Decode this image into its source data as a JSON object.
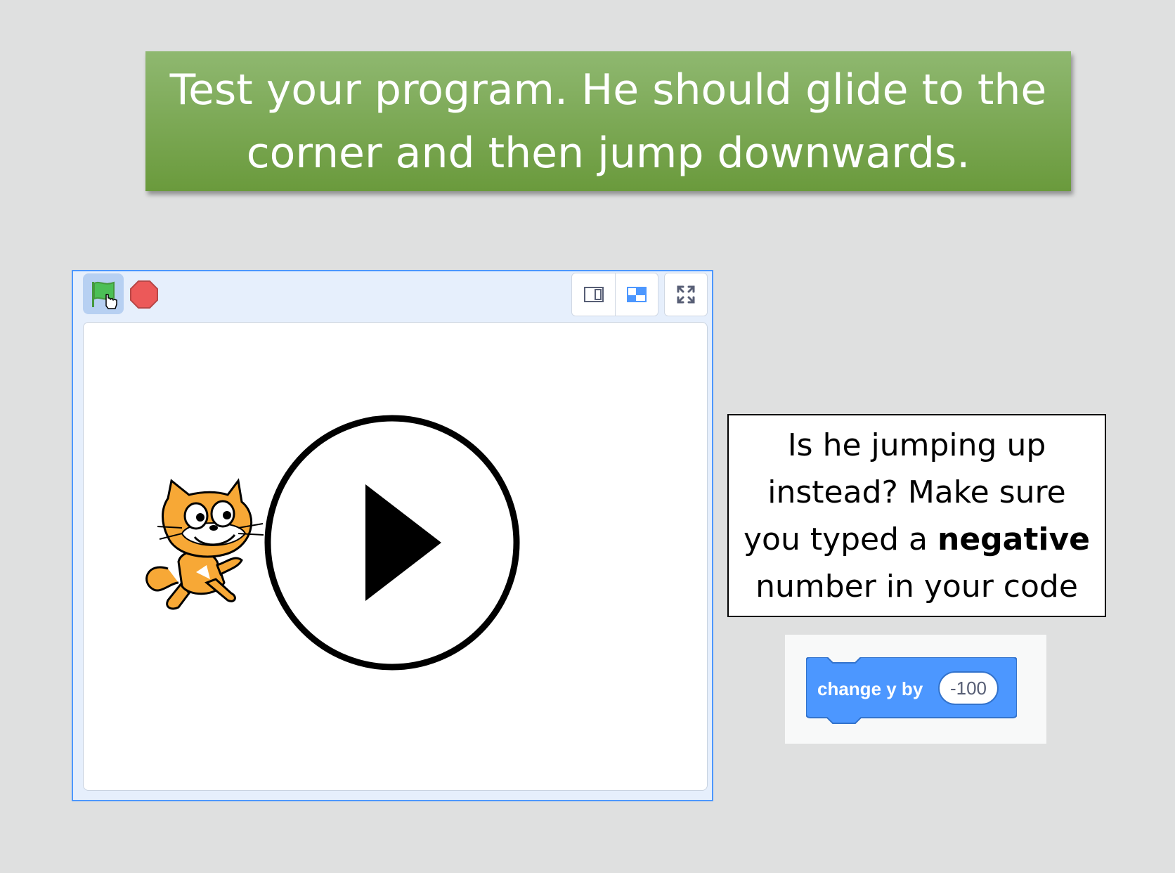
{
  "banner": {
    "line1": "Test your program. He should glide to the",
    "line2": "corner and then jump downwards."
  },
  "stage_controls": {
    "green_flag_icon": "green-flag-icon",
    "stop_icon": "stop-icon",
    "small_stage_icon": "small-stage-icon",
    "normal_stage_icon": "normal-stage-icon",
    "fullscreen_icon": "fullscreen-icon"
  },
  "stage": {
    "sprite": "scratch-cat",
    "overlay_icon": "play-icon"
  },
  "hint": {
    "line1": "Is he jumping up",
    "line2": "instead? Make sure",
    "line3_prefix": "you typed a ",
    "line3_bold": "negative",
    "line4": "number in your code"
  },
  "block": {
    "label": "change y by",
    "value": "-100"
  },
  "colors": {
    "banner": "#77a84b",
    "stage_frame_border": "#4c97ff",
    "block": "#4c97ff",
    "stop": "#ec5959",
    "flag": "#4cbf56"
  }
}
